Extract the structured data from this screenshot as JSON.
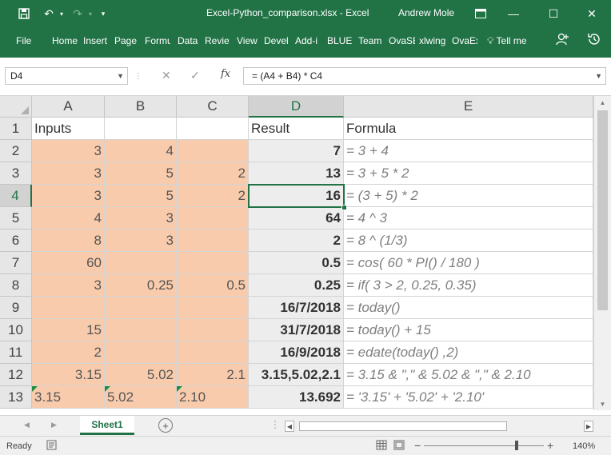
{
  "window": {
    "title": "Excel-Python_comparison.xlsx  -  Excel",
    "user": "Andrew Mole"
  },
  "ribbon": {
    "tabs": [
      "File",
      "Home",
      "Insert",
      "Page",
      "Formu",
      "Data",
      "Review",
      "View",
      "Devel",
      "Add-i",
      "BLUEE",
      "Team",
      "OvaSE",
      "xlwing",
      "OvaEx"
    ],
    "tell_me": "Tell me"
  },
  "formula_bar": {
    "name_box": "D4",
    "formula": "= (A4 + B4) * C4"
  },
  "columns": [
    "A",
    "B",
    "C",
    "D",
    "E"
  ],
  "selected_cell": "D4",
  "rows": [
    {
      "n": "1",
      "a": "Inputs",
      "b": "",
      "c": "",
      "d": "Result",
      "e": "Formula"
    },
    {
      "n": "2",
      "a": "3",
      "b": "4",
      "c": "",
      "d": "7",
      "e": "= 3 + 4"
    },
    {
      "n": "3",
      "a": "3",
      "b": "5",
      "c": "2",
      "d": "13",
      "e": "= 3 + 5 * 2"
    },
    {
      "n": "4",
      "a": "3",
      "b": "5",
      "c": "2",
      "d": "16",
      "e": "= (3 + 5) * 2"
    },
    {
      "n": "5",
      "a": "4",
      "b": "3",
      "c": "",
      "d": "64",
      "e": "= 4 ^ 3"
    },
    {
      "n": "6",
      "a": "8",
      "b": "3",
      "c": "",
      "d": "2",
      "e": "= 8 ^ (1/3)"
    },
    {
      "n": "7",
      "a": "60",
      "b": "",
      "c": "",
      "d": "0.5",
      "e": "= cos( 60 * PI() / 180 )"
    },
    {
      "n": "8",
      "a": "3",
      "b": "0.25",
      "c": "0.5",
      "d": "0.25",
      "e": "= if( 3 > 2, 0.25, 0.35)"
    },
    {
      "n": "9",
      "a": "",
      "b": "",
      "c": "",
      "d": "16/7/2018",
      "e": "= today()"
    },
    {
      "n": "10",
      "a": "15",
      "b": "",
      "c": "",
      "d": "31/7/2018",
      "e": "= today() + 15"
    },
    {
      "n": "11",
      "a": "2",
      "b": "",
      "c": "",
      "d": "16/9/2018",
      "e": "= edate(today() ,2)"
    },
    {
      "n": "12",
      "a": "3.15",
      "b": "5.02",
      "c": "2.1",
      "d": "3.15,5.02,2.1",
      "e": "= 3.15 & \",\" & 5.02 & \",\" & 2.10"
    },
    {
      "n": "13",
      "a": "3.15",
      "b": "5.02",
      "c": "2.10",
      "d": "13.692",
      "e": "= '3.15' + '5.02' + '2.10'"
    }
  ],
  "sheet_tab": "Sheet1",
  "status": {
    "ready": "Ready",
    "zoom": "140%"
  },
  "colors": {
    "accent": "#217346",
    "input_fill": "#f8cbad",
    "result_fill": "#ededed"
  }
}
